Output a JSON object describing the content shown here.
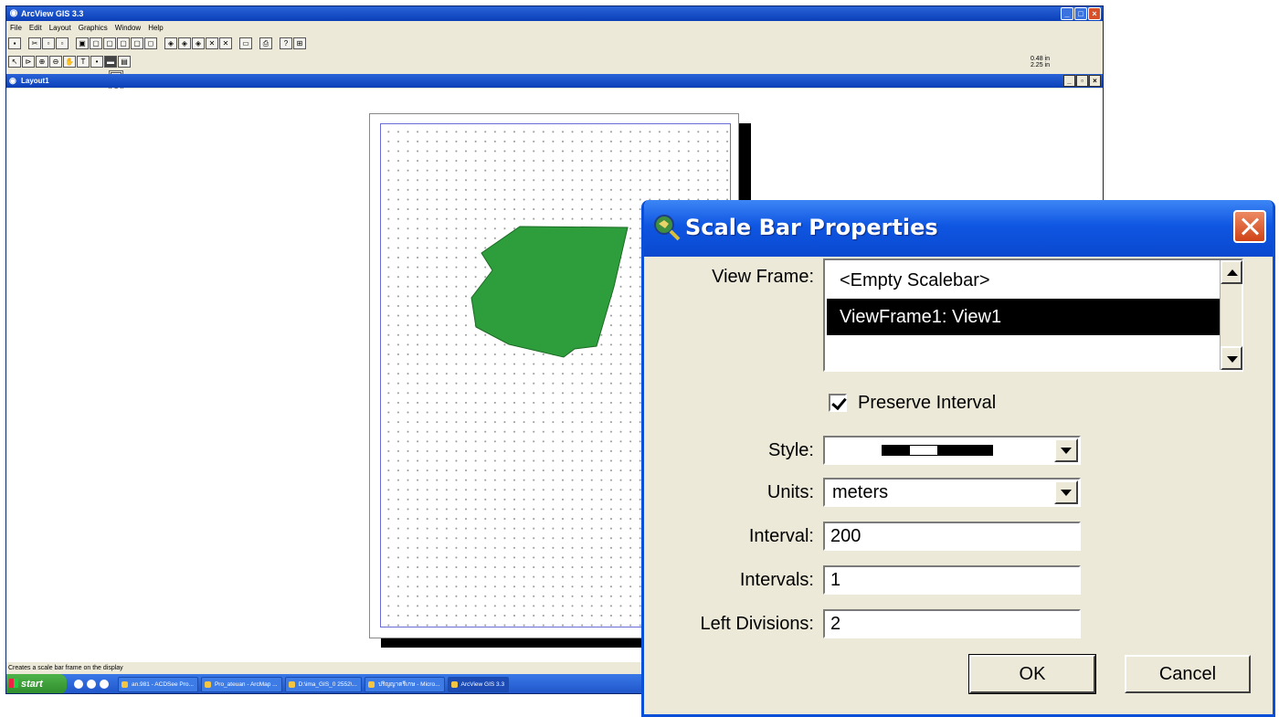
{
  "app": {
    "title": "ArcView GIS 3.3",
    "menu": [
      "File",
      "Edit",
      "Layout",
      "Graphics",
      "Window",
      "Help"
    ],
    "document_title": "Layout1",
    "scale_readout": [
      "0.48 in",
      "2.25 in"
    ],
    "status_text": "Creates a scale bar frame on the display"
  },
  "layout": {
    "map_fill_color": "#2e9e3c",
    "grid_color": "#6b6bd8"
  },
  "taskbar": {
    "start_label": "start",
    "tasks": [
      "an.981 - ACDSee Pro...",
      "Pro_ateuan - ArcMap ...",
      "D:\\ima_GIS_0 2552\\...",
      "ปริญญาตรีเกษ - Micro...",
      "ArcView GIS 3.3"
    ]
  },
  "dialog": {
    "title": "Scale Bar Properties",
    "view_frame_label": "View Frame:",
    "view_frame_items": [
      "<Empty Scalebar>",
      "ViewFrame1: View1"
    ],
    "selected_view_frame": "ViewFrame1: View1",
    "preserve_interval_label": "Preserve Interval",
    "preserve_interval_checked": true,
    "style_label": "Style:",
    "units_label": "Units:",
    "units_value": "meters",
    "interval_label": "Interval:",
    "interval_value": "200",
    "intervals_label": "Intervals:",
    "intervals_value": "1",
    "left_divisions_label": "Left Divisions:",
    "left_divisions_value": "2",
    "ok_label": "OK",
    "cancel_label": "Cancel"
  }
}
